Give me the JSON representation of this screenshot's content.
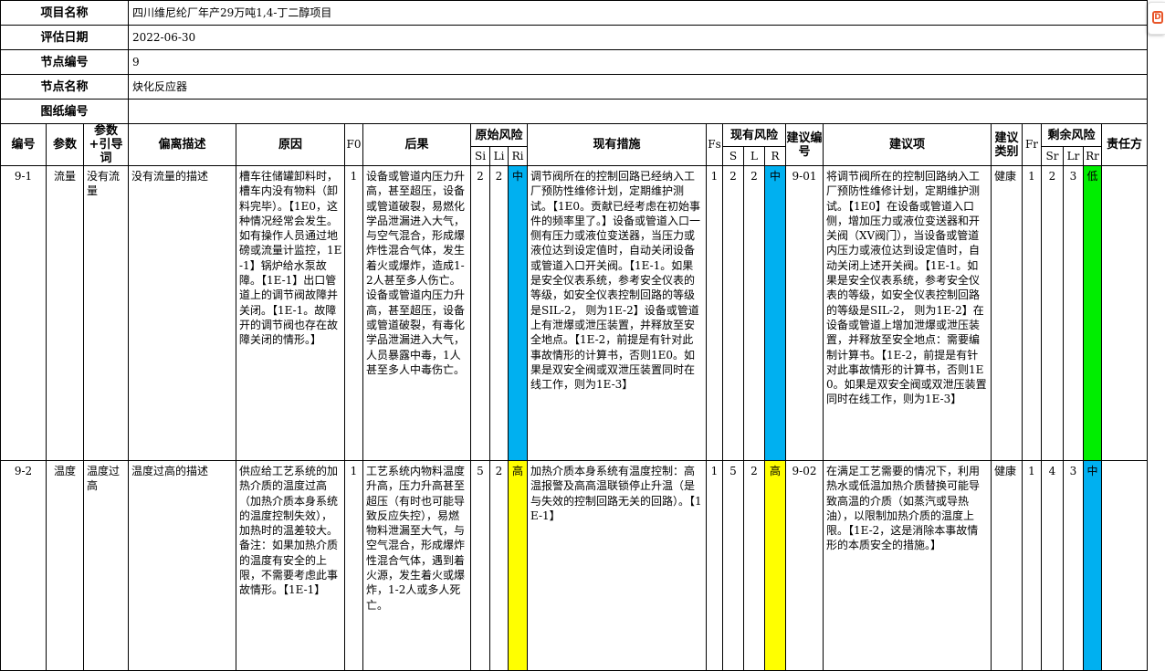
{
  "meta": {
    "project_name_label": "项目名称",
    "project_name": "四川维尼纶厂年产29万吨1,4-丁二醇项目",
    "eval_date_label": "评估日期",
    "eval_date": "2022-06-30",
    "node_no_label": "节点编号",
    "node_no": "9",
    "node_name_label": "节点名称",
    "node_name": "炔化反应器",
    "drawing_no_label": "图纸编号",
    "drawing_no": ""
  },
  "columns": {
    "no": "编号",
    "param": "参数",
    "guide": "参数+引导词",
    "deviation": "偏离描述",
    "cause": "原因",
    "f0": "F0",
    "consequence": "后果",
    "orig_risk": "原始风险",
    "si": "Si",
    "li": "Li",
    "ri": "Ri",
    "measures": "现有措施",
    "fs": "Fs",
    "current_risk": "现有风险",
    "s": "S",
    "l": "L",
    "r": "R",
    "rec_no": "建议编号",
    "recommendation": "建议项",
    "rec_type": "建议类别",
    "fr": "Fr",
    "residual_risk": "剩余风险",
    "sr": "Sr",
    "lr": "Lr",
    "rr": "Rr",
    "owner": "责任方"
  },
  "rows": [
    {
      "no": "9-1",
      "param": "流量",
      "guide": "没有流量",
      "deviation": "没有流量的描述",
      "cause": "槽车往储罐卸料时，槽车内没有物料（卸料完毕）。【1E0，这种情况经常会发生。如有操作人员通过地磅或流量计监控，1E-1】锅炉给水泵故障。【1E-1】出口管道上的调节阀故障并关闭。【1E-1。故障开的调节阀也存在故障关闭的情形。】",
      "f0": "1",
      "consequence": "设备或管道内压力升高，甚至超压，设备或管道破裂，易燃化学品泄漏进入大气，与空气混合，形成爆炸性混合气体，发生着火或爆炸，造成1-2人甚至多人伤亡。设备或管道内压力升高，甚至超压，设备或管道破裂，有毒化学品泄漏进入大气，人员暴露中毒，1人甚至多人中毒伤亡。",
      "si": "2",
      "li": "2",
      "ri": "中",
      "ri_color": "#00b0f0",
      "measures": "调节阀所在的控制回路已经纳入工厂预防性维修计划，定期维护测试。【1E0。贡献已经考虑在初始事件的频率里了。】设备或管道入口一侧有压力或液位变送器，当压力或液位达到设定值时，自动关闭设备或管道入口开关阀。【1E-1。如果是安全仪表系统，参考安全仪表的等级，如安全仪表控制回路的等级是SIL-2，  则为1E-2】设备或管道上有泄爆或泄压装置，并释放至安全地点。【1E-2，前提是有针对此事故情形的计算书，否则1E0。如果是双安全阀或双泄压装置同时在线工作，则为1E-3】",
      "fs": "1",
      "s": "2",
      "l": "2",
      "r": "中",
      "r_color": "#00b0f0",
      "rec_no": "9-01",
      "recommendation": "将调节阀所在的控制回路纳入工厂预防性维修计划，定期维护测试。【1E0】在设备或管道入口侧，增加压力或液位变送器和开关阀（XV阀门），当设备或管道内压力或液位达到设定值时，自动关闭上述开关阀。【1E-1。如果是安全仪表系统，参考安全仪表的等级，如安全仪表控制回路的等级是SIL-2，  则为1E-2】在设备或管道上增加泄爆或泄压装置，并释放至安全地点：需要编制计算书。【1E-2，前提是有针对此事故情形的计算书，否则1E0。如果是双安全阀或双泄压装置同时在线工作，则为1E-3】",
      "rec_type": "健康",
      "fr": "1",
      "sr": "2",
      "lr": "3",
      "rr": "低",
      "rr_color": "#00ee00",
      "owner": ""
    },
    {
      "no": "9-2",
      "param": "温度",
      "guide": "温度过高",
      "deviation": "温度过高的描述",
      "cause": "供应给工艺系统的加热介质的温度过高（加热介质本身系统的温度控制失效），加热时的温差较大。备注：如果加热介质的温度有安全的上限，不需要考虑此事故情形。【1E-1】",
      "f0": "1",
      "consequence": "工艺系统内物料温度升高，压力升高甚至超压（有时也可能导致反应失控），易燃物料泄漏至大气，与空气混合，形成爆炸性混合气体，遇到着火源，发生着火或爆炸，1-2人或多人死亡。",
      "si": "5",
      "li": "2",
      "ri": "高",
      "ri_color": "#ffff00",
      "measures": "加热介质本身系统有温度控制：高温报警及高高温联锁停止升温（是与失效的控制回路无关的回路）。【1E-1】",
      "fs": "1",
      "s": "5",
      "l": "2",
      "r": "高",
      "r_color": "#ffff00",
      "rec_no": "9-02",
      "recommendation": "在满足工艺需要的情况下，利用热水或低温加热介质替换可能导致高温的介质（如蒸汽或导热油），以限制加热介质的温度上限。【1E-2，这是消除本事故情形的本质安全的措施。】",
      "rec_type": "健康",
      "fr": "1",
      "sr": "4",
      "lr": "3",
      "rr": "中",
      "rr_color": "#00b0f0",
      "owner": ""
    }
  ],
  "side_icon": "office-assistant-icon"
}
